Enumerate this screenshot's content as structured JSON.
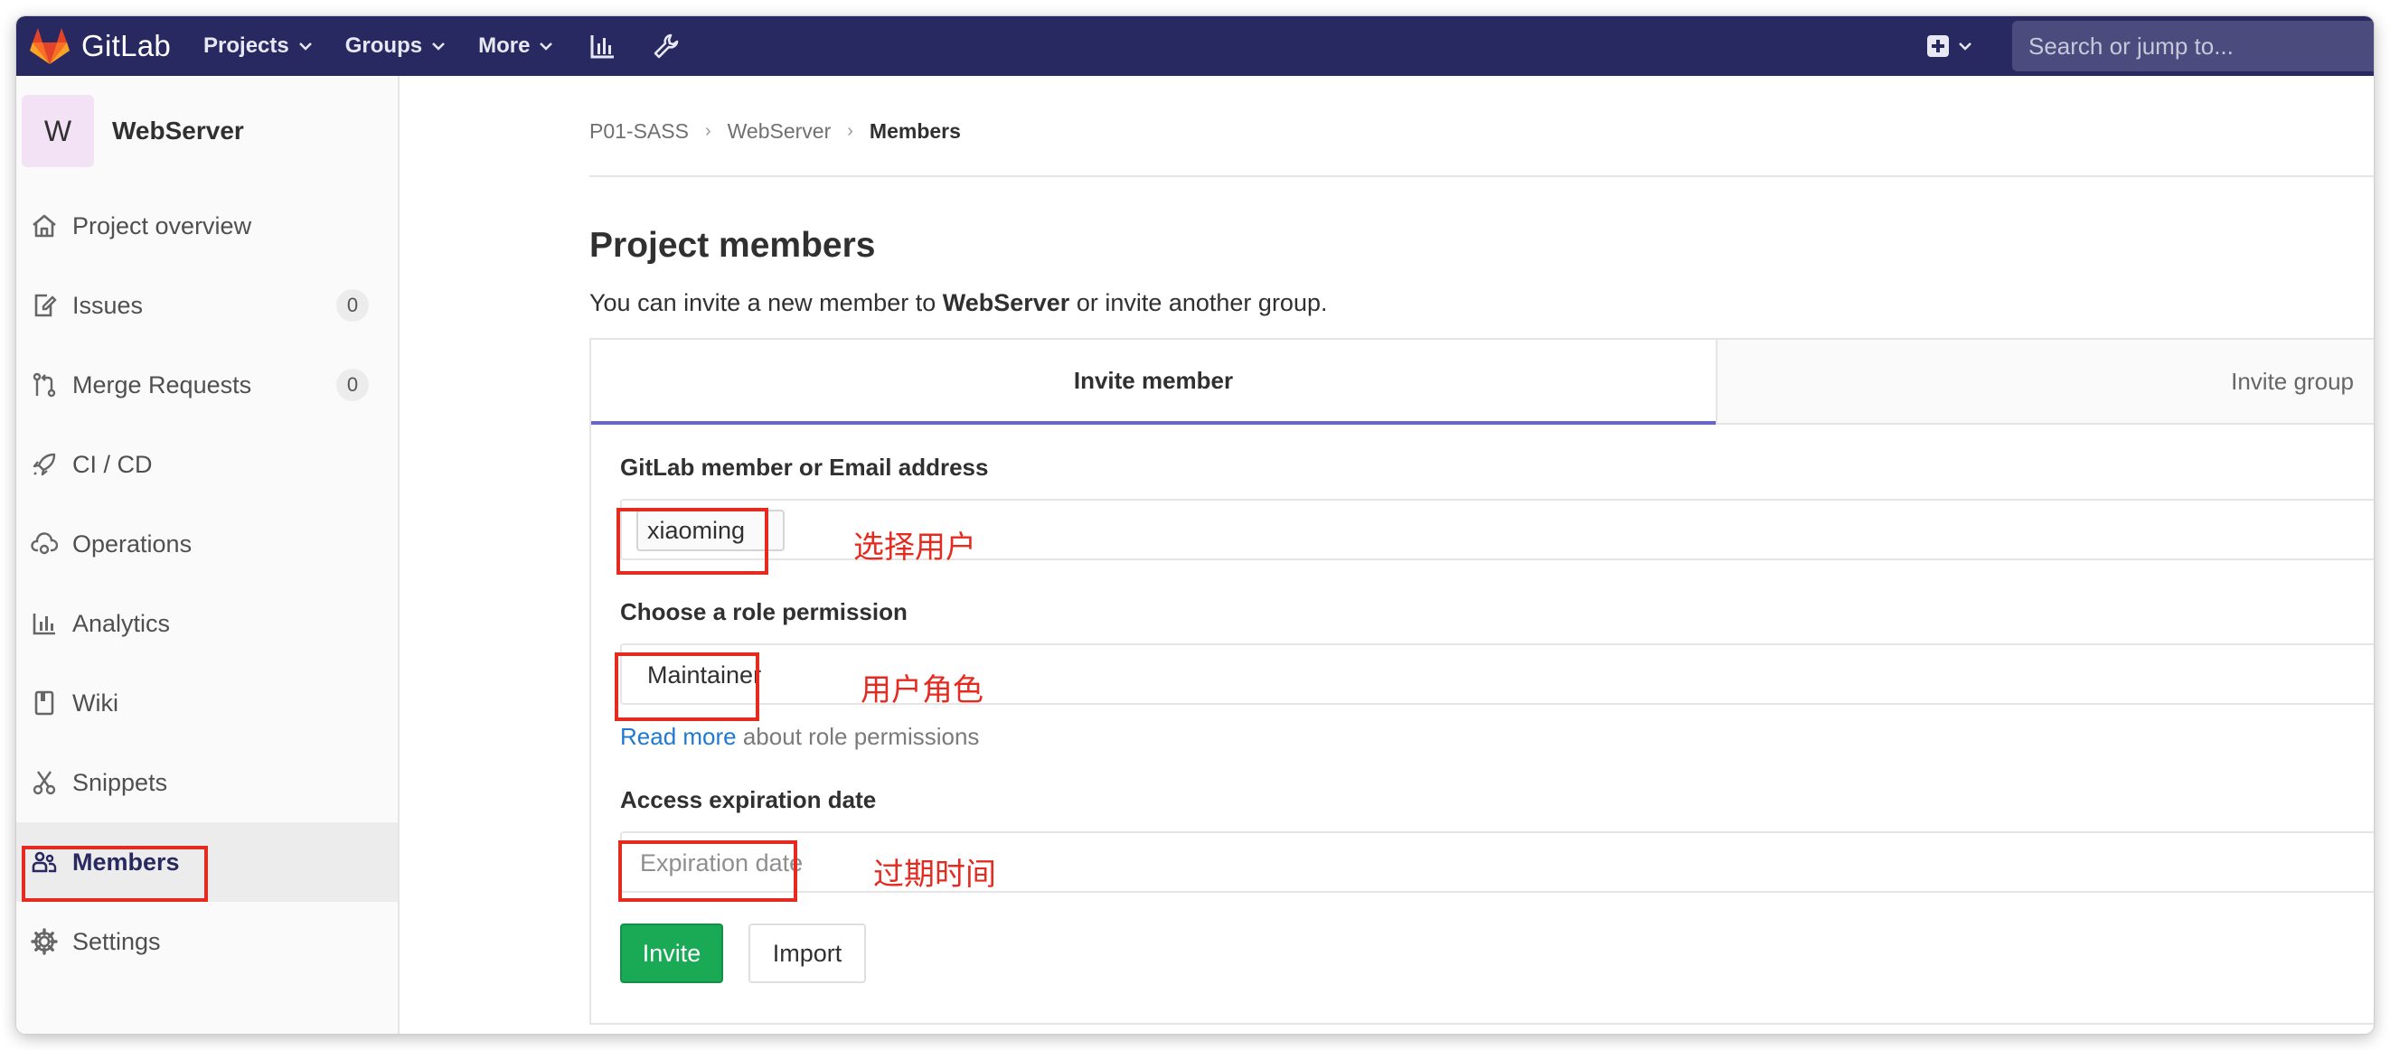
{
  "navbar": {
    "brand": "GitLab",
    "menu": [
      {
        "label": "Projects"
      },
      {
        "label": "Groups"
      },
      {
        "label": "More"
      }
    ],
    "icons": [
      "analytics-icon",
      "wrench-icon",
      "plus-square-icon"
    ],
    "search_placeholder": "Search or jump to..."
  },
  "sidebar": {
    "project_initial": "W",
    "project_name": "WebServer",
    "items": [
      {
        "label": "Project overview",
        "icon": "home-icon"
      },
      {
        "label": "Issues",
        "icon": "issues-icon",
        "count": "0"
      },
      {
        "label": "Merge Requests",
        "icon": "merge-request-icon",
        "count": "0"
      },
      {
        "label": "CI / CD",
        "icon": "rocket-icon"
      },
      {
        "label": "Operations",
        "icon": "cloud-gear-icon"
      },
      {
        "label": "Analytics",
        "icon": "chart-icon"
      },
      {
        "label": "Wiki",
        "icon": "book-icon"
      },
      {
        "label": "Snippets",
        "icon": "scissors-icon"
      },
      {
        "label": "Members",
        "icon": "users-icon",
        "active": true
      },
      {
        "label": "Settings",
        "icon": "gear-icon"
      }
    ]
  },
  "breadcrumb": [
    "P01-SASS",
    "WebServer",
    "Members"
  ],
  "page": {
    "title": "Project members",
    "subtitle_pre": "You can invite a new member to ",
    "subtitle_bold": "WebServer",
    "subtitle_post": " or invite another group."
  },
  "tabs": {
    "invite_member": "Invite member",
    "invite_group": "Invite group"
  },
  "form": {
    "member_label": "GitLab member or Email address",
    "member_value": "xiaoming",
    "member_annotation": "选择用户",
    "role_label": "Choose a role permission",
    "role_value": "Maintainer",
    "role_annotation": "用户角色",
    "read_more_link": "Read more",
    "read_more_text": " about role permissions",
    "expiry_label": "Access expiration date",
    "expiry_placeholder": "Expiration date",
    "expiry_annotation": "过期时间",
    "invite_button": "Invite",
    "import_button": "Import"
  },
  "colors": {
    "navbar": "#292961",
    "annotation": "#e52b1f",
    "invite_button": "#1aaa55",
    "active_tab_underline": "#6666c4",
    "link": "#1f78d1"
  }
}
